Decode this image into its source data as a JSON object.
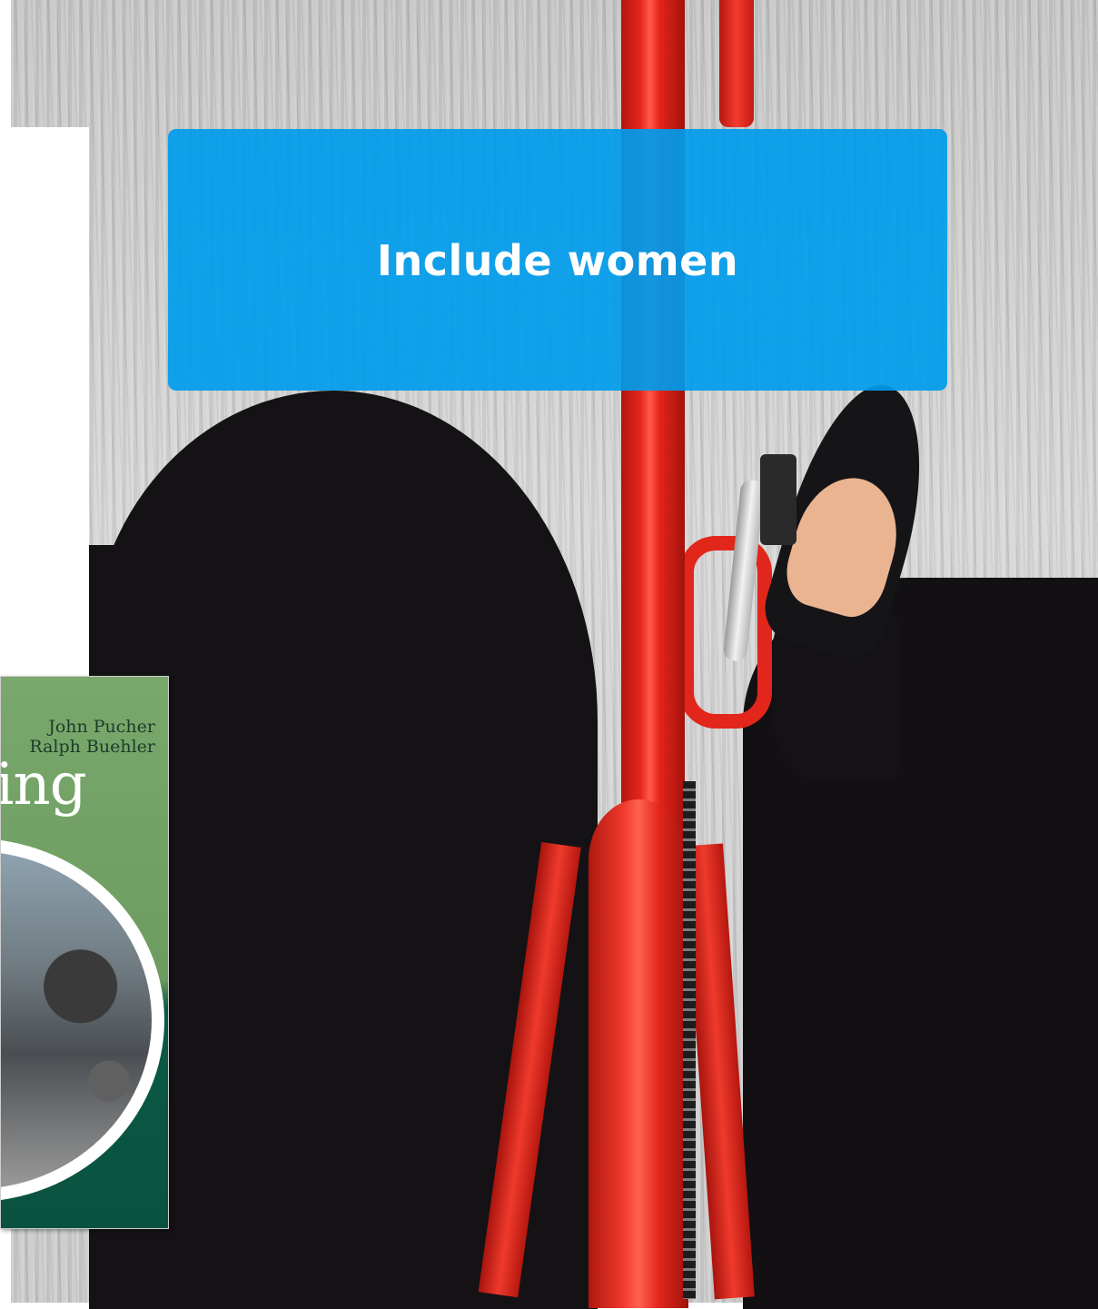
{
  "callout": {
    "text": "Include women",
    "background_color": "#0a9fe8",
    "text_color": "#ffffff"
  },
  "book_cover": {
    "author_1": "John Pucher",
    "author_2": "Ralph Buehler",
    "title_fragment": "ing",
    "cover_color": "#6d9c60"
  },
  "photo": {
    "frame_color": "#e5261c"
  }
}
